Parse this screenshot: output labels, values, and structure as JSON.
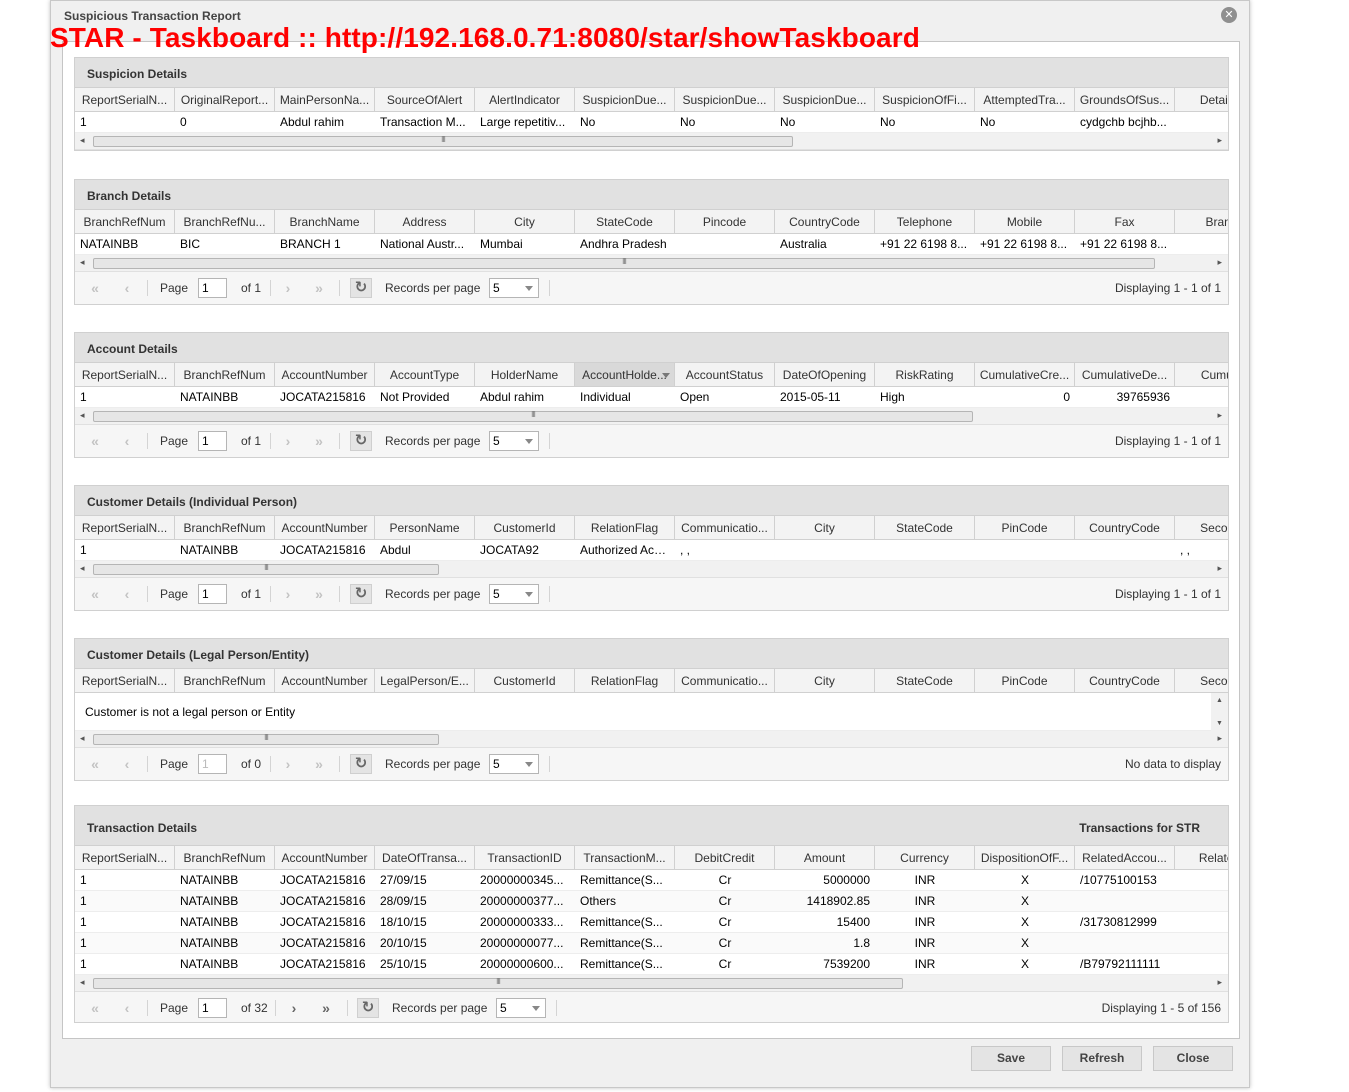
{
  "window": {
    "title": "Suspicious Transaction Report",
    "close_glyph": "✕",
    "overlay_url": "STAR - Taskboard :: http://192.168.0.71:8080/star/showTaskboard"
  },
  "pager_labels": {
    "page": "Page",
    "records_per_page": "Records per page"
  },
  "sections": {
    "suspicion": {
      "title": "Suspicion Details",
      "columns": [
        "ReportSerialN...",
        "OriginalReport...",
        "MainPersonNa...",
        "SourceOfAlert",
        "AlertIndicator",
        "SuspicionDue...",
        "SuspicionDue...",
        "SuspicionDue...",
        "SuspicionOfFi...",
        "AttemptedTra...",
        "GroundsOfSus...",
        "DetailsOf"
      ],
      "rows": [
        [
          "1",
          "0",
          "Abdul rahim",
          "Transaction M...",
          "Large repetitiv...",
          "No",
          "No",
          "No",
          "No",
          "No",
          "cydgchb bcjhb...",
          ""
        ]
      ]
    },
    "branch": {
      "title": "Branch Details",
      "columns": [
        "BranchRefNum",
        "BranchRefNu...",
        "BranchName",
        "Address",
        "City",
        "StateCode",
        "Pincode",
        "CountryCode",
        "Telephone",
        "Mobile",
        "Fax",
        "Branch"
      ],
      "rows": [
        [
          "NATAINBB",
          "BIC",
          "BRANCH 1",
          "National Austr...",
          "Mumbai",
          "Andhra Pradesh",
          "",
          "Australia",
          "+91 22 6198 8...",
          "+91 22 6198 8...",
          "+91 22 6198 8...",
          ""
        ]
      ],
      "pager": {
        "page": "1",
        "of": "of 1",
        "per_page": "5",
        "display": "Displaying 1 - 1 of 1"
      }
    },
    "account": {
      "title": "Account Details",
      "columns": [
        "ReportSerialN...",
        "BranchRefNum",
        "AccountNumber",
        "AccountType",
        "HolderName",
        "AccountHolde...",
        "AccountStatus",
        "DateOfOpening",
        "RiskRating",
        "CumulativeCre...",
        "CumulativeDe...",
        "Cumulati"
      ],
      "rows": [
        [
          "1",
          "NATAINBB",
          "JOCATA215816",
          "Not Provided",
          "Abdul rahim",
          "Individual",
          "Open",
          "2015-05-11",
          "High",
          "0",
          "39765936",
          ""
        ]
      ],
      "pager": {
        "page": "1",
        "of": "of 1",
        "per_page": "5",
        "display": "Displaying 1 - 1 of 1"
      }
    },
    "customer_individual": {
      "title": "Customer Details (Individual Person)",
      "columns": [
        "ReportSerialN...",
        "BranchRefNum",
        "AccountNumber",
        "PersonName",
        "CustomerId",
        "RelationFlag",
        "Communicatio...",
        "City",
        "StateCode",
        "PinCode",
        "CountryCode",
        "SecondA"
      ],
      "rows": [
        [
          "1",
          "NATAINBB",
          "JOCATA215816",
          "Abdul",
          "JOCATA92",
          "Authorized Acc...",
          ", ,",
          "",
          "",
          "",
          "",
          ", ,"
        ]
      ],
      "pager": {
        "page": "1",
        "of": "of 1",
        "per_page": "5",
        "display": "Displaying 1 - 1 of 1"
      }
    },
    "customer_legal": {
      "title": "Customer Details (Legal Person/Entity)",
      "columns": [
        "ReportSerialN...",
        "BranchRefNum",
        "AccountNumber",
        "LegalPerson/E...",
        "CustomerId",
        "RelationFlag",
        "Communicatio...",
        "City",
        "StateCode",
        "PinCode",
        "CountryCode",
        "SecondA"
      ],
      "empty_message": "Customer is not a legal person or Entity",
      "pager": {
        "page": "1",
        "of": "of 0",
        "per_page": "5",
        "display": "No data to display"
      }
    },
    "transaction": {
      "title": "Transaction Details",
      "title_right": "Transactions for STR",
      "columns": [
        "ReportSerialN...",
        "BranchRefNum",
        "AccountNumber",
        "DateOfTransa...",
        "TransactionID",
        "TransactionM...",
        "DebitCredit",
        "Amount",
        "Currency",
        "DispositionOfF...",
        "RelatedAccou...",
        "RelatedIn"
      ],
      "rows": [
        [
          "1",
          "NATAINBB",
          "JOCATA215816",
          "27/09/15",
          "20000000345...",
          "Remittance(S...",
          "Cr",
          "5000000",
          "INR",
          "X",
          "/10775100153",
          ""
        ],
        [
          "1",
          "NATAINBB",
          "JOCATA215816",
          "28/09/15",
          "20000000377...",
          "Others",
          "Cr",
          "1418902.85",
          "INR",
          "X",
          "",
          ""
        ],
        [
          "1",
          "NATAINBB",
          "JOCATA215816",
          "18/10/15",
          "20000000333...",
          "Remittance(S...",
          "Cr",
          "15400",
          "INR",
          "X",
          "/31730812999",
          ""
        ],
        [
          "1",
          "NATAINBB",
          "JOCATA215816",
          "20/10/15",
          "20000000077...",
          "Remittance(S...",
          "Cr",
          "1.8",
          "INR",
          "X",
          "",
          ""
        ],
        [
          "1",
          "NATAINBB",
          "JOCATA215816",
          "25/10/15",
          "20000000600...",
          "Remittance(S...",
          "Cr",
          "7539200",
          "INR",
          "X",
          "/B79792111111",
          ""
        ]
      ],
      "pager": {
        "page": "1",
        "of": "of 32",
        "per_page": "5",
        "display": "Displaying 1 - 5 of 156"
      }
    }
  },
  "footer": {
    "save": "Save",
    "refresh": "Refresh",
    "close": "Close"
  }
}
